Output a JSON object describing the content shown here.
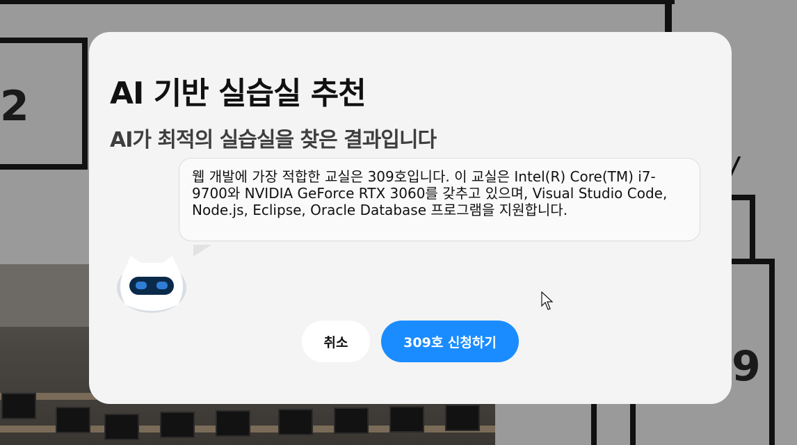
{
  "background": {
    "room_labels": [
      "2",
      "9"
    ]
  },
  "modal": {
    "title": "AI 기반 실습실 추천",
    "subtitle": "AI가 최적의 실습실을 찾은 결과입니다",
    "message": "웹 개발에 가장 적합한 교실은 309호입니다. 이 교실은 Intel(R) Core(TM) i7-9700와 NVIDIA GeForce RTX 3060를 갖추고 있으며, Visual Studio Code, Node.js, Eclipse, Oracle Database 프로그램을 지원합니다.",
    "cancel_label": "취소",
    "apply_label": "309호 신청하기",
    "accent_color": "#1a8cff",
    "mascot_icon": "robot-mascot-icon"
  }
}
